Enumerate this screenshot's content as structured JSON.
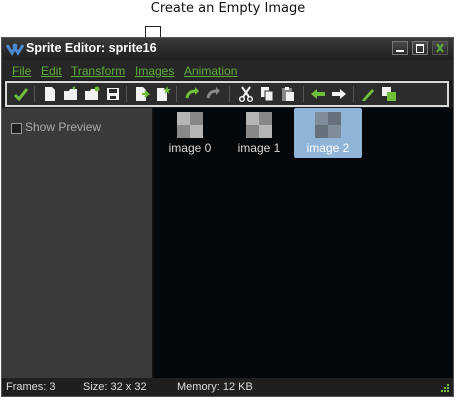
{
  "callout": {
    "text": "Create an Empty Image"
  },
  "window": {
    "title": "Sprite Editor: sprite16",
    "menu": [
      "File",
      "Edit",
      "Transform",
      "Images",
      "Animation"
    ]
  },
  "toolbar": {
    "icons": [
      "confirm-check-icon",
      "new-document-icon",
      "open-folder-icon",
      "open-new-icon",
      "save-icon",
      "add-image-icon",
      "create-empty-image-icon",
      "undo-icon",
      "redo-icon",
      "cut-icon",
      "copy-icon",
      "paste-icon",
      "arrow-left-icon",
      "arrow-right-icon",
      "pencil-edit-icon",
      "overlay-icon"
    ]
  },
  "left_panel": {
    "show_preview_label": "Show Preview",
    "show_preview_checked": false
  },
  "images": [
    {
      "label": "image 0",
      "selected": false
    },
    {
      "label": "image 1",
      "selected": false
    },
    {
      "label": "image 2",
      "selected": true
    }
  ],
  "status": {
    "frames": "Frames: 3",
    "size": "Size: 32 x 32",
    "memory": "Memory: 12 KB"
  },
  "colors": {
    "menu_text": "#5fae3a",
    "selection": "#8fb4d8",
    "canvas": "#05080b"
  }
}
